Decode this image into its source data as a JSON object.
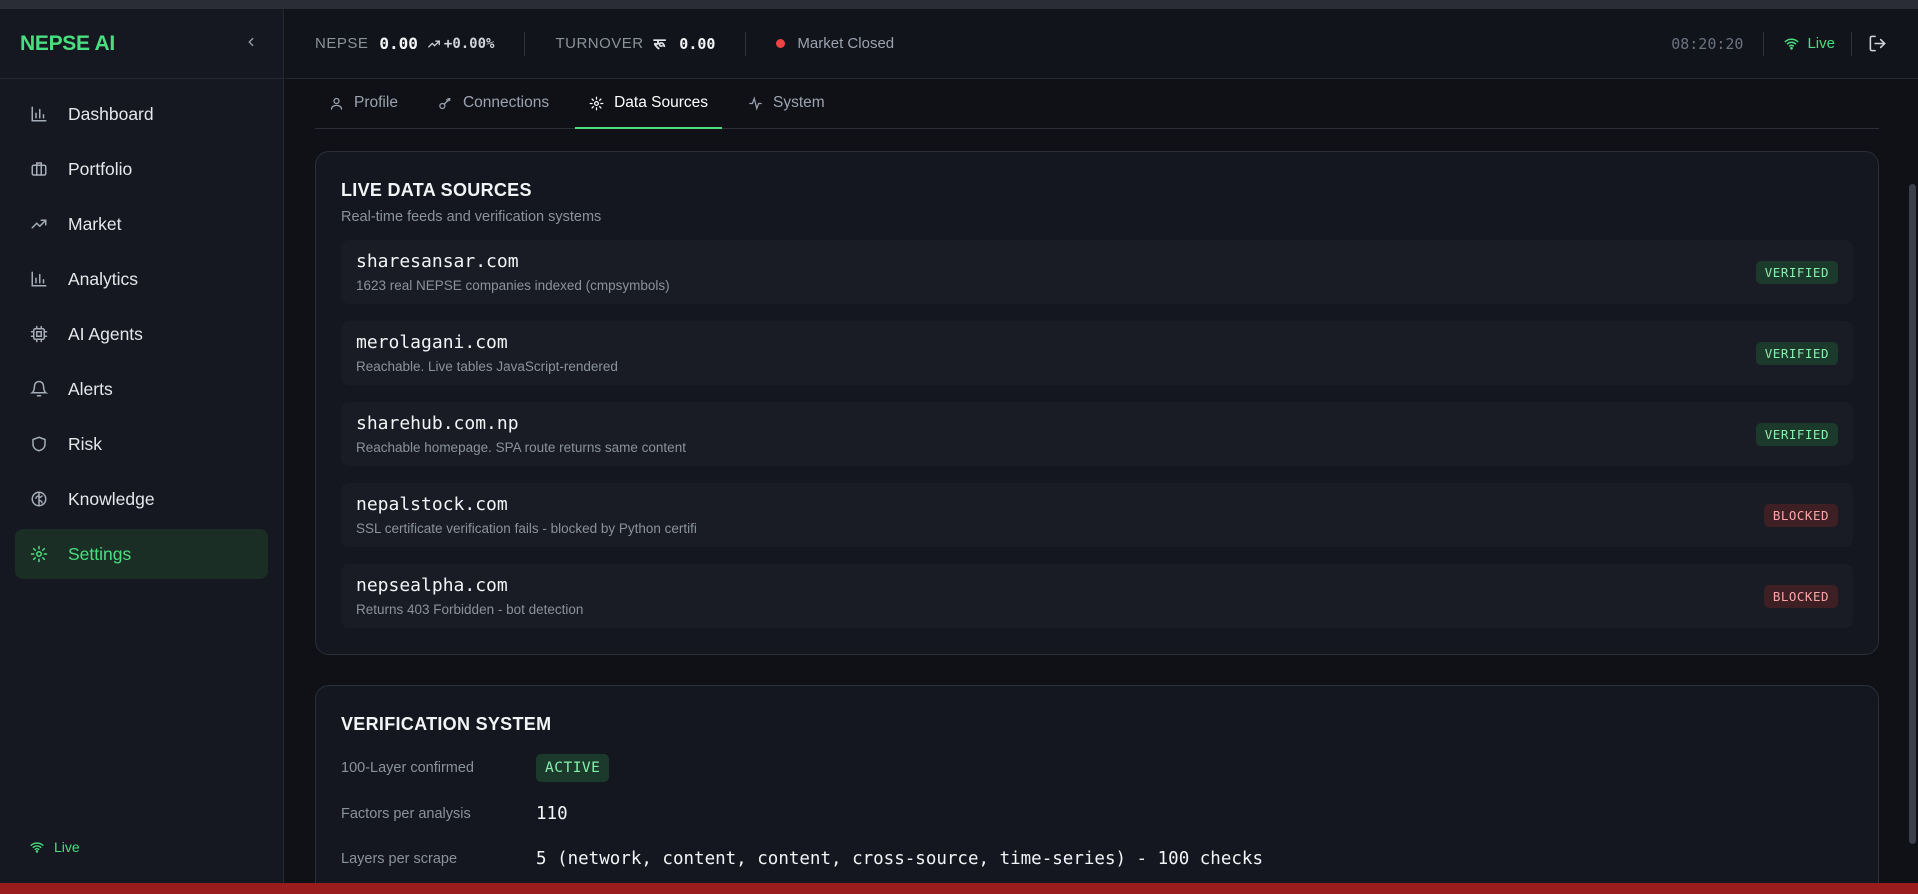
{
  "brand": {
    "name": "NEPSE AI",
    "collapse_icon": "‹"
  },
  "sidebar": {
    "items": [
      {
        "label": "Dashboard",
        "icon": "bar-chart-icon"
      },
      {
        "label": "Portfolio",
        "icon": "briefcase-icon"
      },
      {
        "label": "Market",
        "icon": "trending-up-icon"
      },
      {
        "label": "Analytics",
        "icon": "bar-chart-icon"
      },
      {
        "label": "AI Agents",
        "icon": "cpu-icon"
      },
      {
        "label": "Alerts",
        "icon": "bell-icon"
      },
      {
        "label": "Risk",
        "icon": "shield-icon"
      },
      {
        "label": "Knowledge",
        "icon": "brain-icon"
      },
      {
        "label": "Settings",
        "icon": "gear-icon",
        "active": true
      }
    ],
    "live_label": "Live"
  },
  "header": {
    "nepse_label": "NEPSE",
    "nepse_value": "0.00",
    "nepse_change": "+0.00%",
    "turnover_label": "TURNOVER",
    "turnover_symbol": "रू",
    "turnover_value": "0.00",
    "market_status": "Market Closed",
    "clock": "08:20:20",
    "live_label": "Live"
  },
  "tabs": [
    {
      "label": "Profile",
      "icon": "user-icon"
    },
    {
      "label": "Connections",
      "icon": "key-icon"
    },
    {
      "label": "Data Sources",
      "icon": "gear-icon",
      "active": true
    },
    {
      "label": "System",
      "icon": "activity-icon"
    }
  ],
  "live_sources": {
    "title": "LIVE DATA SOURCES",
    "subtitle": "Real-time feeds and verification systems",
    "items": [
      {
        "name": "sharesansar.com",
        "desc": "1623 real NEPSE companies indexed (cmpsymbols)",
        "status": "VERIFIED"
      },
      {
        "name": "merolagani.com",
        "desc": "Reachable. Live tables JavaScript-rendered",
        "status": "VERIFIED"
      },
      {
        "name": "sharehub.com.np",
        "desc": "Reachable homepage. SPA route returns same content",
        "status": "VERIFIED"
      },
      {
        "name": "nepalstock.com",
        "desc": "SSL certificate verification fails - blocked by Python certifi",
        "status": "BLOCKED"
      },
      {
        "name": "nepsealpha.com",
        "desc": "Returns 403 Forbidden - bot detection",
        "status": "BLOCKED"
      }
    ]
  },
  "verification": {
    "title": "VERIFICATION SYSTEM",
    "rows": [
      {
        "label": "100-Layer confirmed",
        "value": "ACTIVE"
      },
      {
        "label": "Factors per analysis",
        "value": "110"
      },
      {
        "label": "Layers per scrape",
        "value": "5 (network, content, content, cross-source, time-series) - 100 checks"
      }
    ]
  },
  "colors": {
    "accent": "#4ade80",
    "danger": "#ef4444",
    "bg": "#0f1117"
  }
}
